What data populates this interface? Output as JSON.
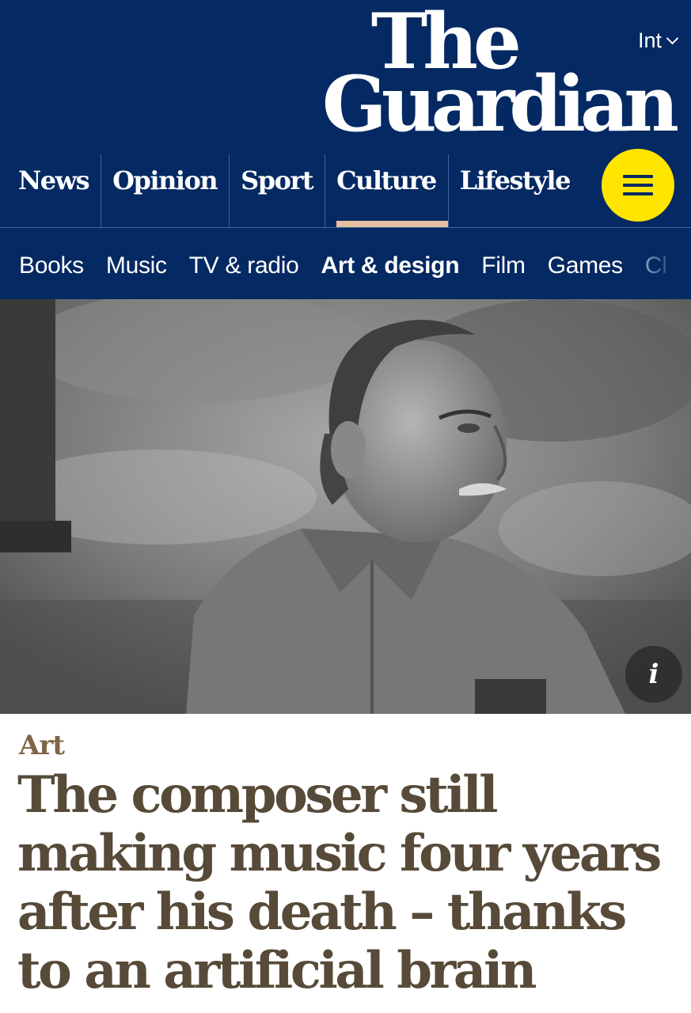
{
  "header": {
    "edition": "Int",
    "logo_line1": "The",
    "logo_line2": "Guardian",
    "pillars": [
      {
        "label": "News"
      },
      {
        "label": "Opinion"
      },
      {
        "label": "Sport"
      },
      {
        "label": "Culture",
        "active": true
      },
      {
        "label": "Lifestyle"
      }
    ],
    "menu_icon": "hamburger-icon",
    "colors": {
      "brand": "#052962",
      "menu": "#ffe500",
      "culture_accent": "#e5c0a0"
    }
  },
  "subnav": {
    "items": [
      {
        "label": "Books"
      },
      {
        "label": "Music"
      },
      {
        "label": "TV & radio"
      },
      {
        "label": "Art & design",
        "active": true
      },
      {
        "label": "Film"
      },
      {
        "label": "Games"
      },
      {
        "label": "Cl"
      }
    ]
  },
  "image": {
    "info_icon": "info-icon",
    "info_label": "i"
  },
  "article": {
    "kicker": "Art",
    "headline": "The composer still making music four years after his death – thanks to an artificial brain",
    "colors": {
      "kicker": "#7e6547",
      "headline": "#574a38"
    }
  }
}
